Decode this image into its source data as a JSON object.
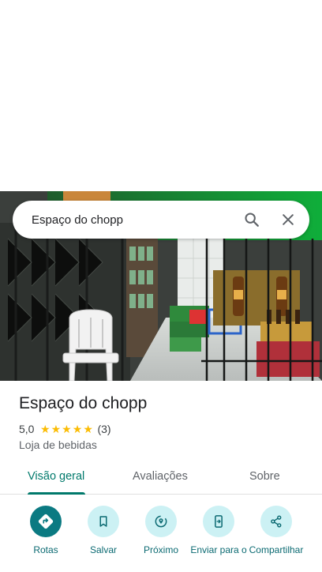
{
  "search": {
    "query": "Espaço do chopp"
  },
  "place": {
    "name": "Espaço do chopp",
    "rating": "5,0",
    "star_count": 5,
    "reviews": "(3)",
    "category": "Loja de bebidas"
  },
  "tabs": [
    {
      "label": "Visão geral",
      "active": true
    },
    {
      "label": "Avaliações",
      "active": false
    },
    {
      "label": "Sobre",
      "active": false
    }
  ],
  "actions": [
    {
      "label": "Rotas",
      "icon": "directions-icon"
    },
    {
      "label": "Salvar",
      "icon": "bookmark-icon"
    },
    {
      "label": "Próximo",
      "icon": "nearby-icon"
    },
    {
      "label": "Enviar para o",
      "icon": "send-to-phone-icon"
    },
    {
      "label": "Compartilhar",
      "icon": "share-icon"
    }
  ],
  "colors": {
    "accent": "#00796b",
    "action_bg": "#ccf1f4",
    "primary_action_bg": "#0b7a82",
    "star": "#fbbc04"
  }
}
